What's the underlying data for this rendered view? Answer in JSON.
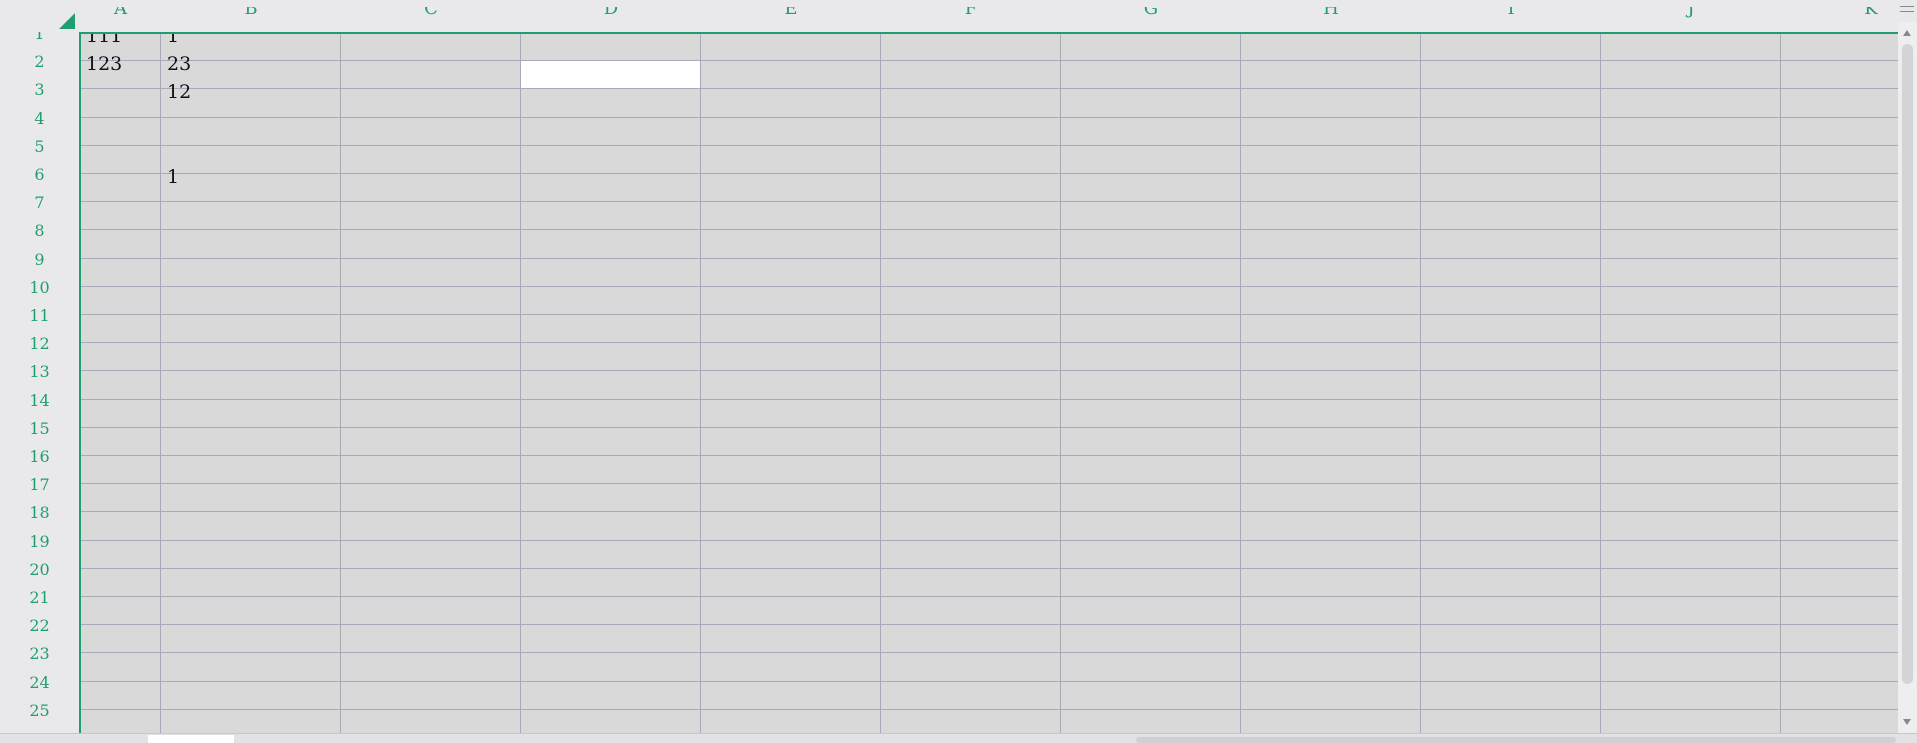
{
  "columns": [
    "A",
    "B",
    "C",
    "D",
    "E",
    "F",
    "G",
    "H",
    "I",
    "J",
    "K"
  ],
  "rows": [
    "1",
    "2",
    "3",
    "4",
    "5",
    "6",
    "7",
    "8",
    "9",
    "10",
    "11",
    "12",
    "13",
    "14",
    "15",
    "16",
    "17",
    "18",
    "19",
    "20",
    "21",
    "22",
    "23",
    "24",
    "25"
  ],
  "cells": [
    {
      "ref": "A1",
      "value": "111"
    },
    {
      "ref": "B1",
      "value": "1"
    },
    {
      "ref": "A2",
      "value": "123"
    },
    {
      "ref": "B2",
      "value": "23"
    },
    {
      "ref": "B3",
      "value": "12"
    },
    {
      "ref": "B6",
      "value": "1"
    }
  ],
  "selected_cell": "D2",
  "colors": {
    "accent": "#1f9e70",
    "grid_bg": "#d9d9d9",
    "grid_line": "#a9a9b8",
    "selected_bg": "#ffffff"
  },
  "icons": {
    "corner": "select-all-triangle-icon",
    "menu": "hamburger-menu-icon",
    "scroll_up": "arrow-up-icon",
    "scroll_down": "arrow-down-icon"
  }
}
